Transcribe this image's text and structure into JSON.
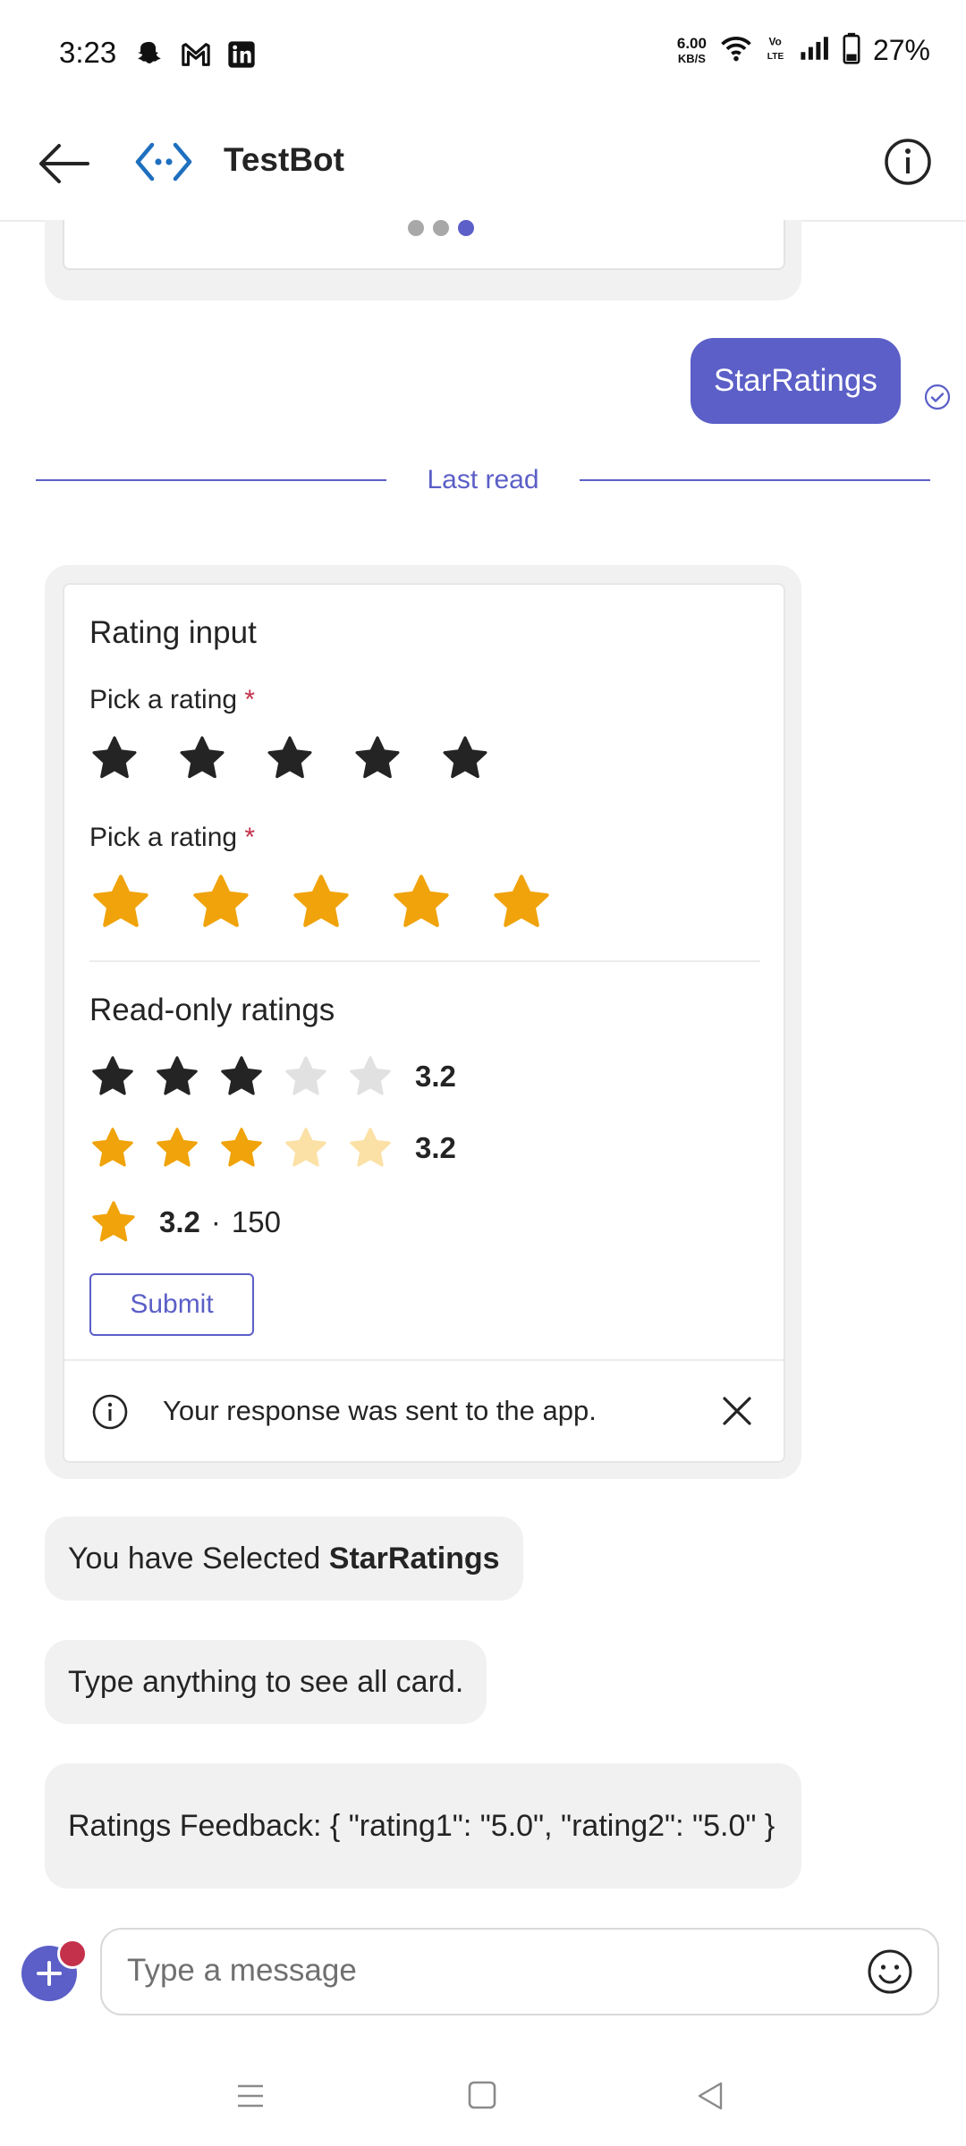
{
  "status_bar": {
    "time": "3:23",
    "net_speed_value": "6.00",
    "net_speed_unit": "KB/S",
    "battery": "27%",
    "icons": [
      "snapchat-icon",
      "gmail-icon",
      "linkedin-icon",
      "wifi-icon",
      "volte-icon",
      "signal-icon",
      "battery-icon"
    ]
  },
  "header": {
    "title": "TestBot",
    "icons": [
      "back-arrow-icon",
      "bot-icon",
      "info-icon"
    ]
  },
  "carousel": {
    "total": 3,
    "active": 3
  },
  "sent_message": "StarRatings",
  "last_read_label": "Last read",
  "card": {
    "title": "Rating input",
    "pick1_label": "Pick a rating",
    "pick2_label": "Pick a rating",
    "required_mark": "*",
    "star_input_1": {
      "count": 5,
      "color": "#242424"
    },
    "star_input_2": {
      "count": 5,
      "color": "#f0a30a"
    },
    "readonly_title": "Read-only ratings",
    "readonly_1": {
      "value": "3.2",
      "filled": 3,
      "total": 5,
      "color": "#242424"
    },
    "readonly_2": {
      "value": "3.2",
      "filled": 3,
      "total": 5,
      "color": "#f0a30a"
    },
    "readonly_3": {
      "value": "3.2",
      "separator": "·",
      "count": "150"
    },
    "submit_label": "Submit",
    "notice_text": "Your response was sent to the app."
  },
  "messages": {
    "selected_prefix": "You have Selected",
    "selected_bold": "StarRatings",
    "hint": "Type anything to see all card.",
    "feedback": "Ratings Feedback: { \"rating1\": \"5.0\", \"rating2\": \"5.0\" }"
  },
  "composer": {
    "placeholder": "Type a message"
  },
  "colors": {
    "accent": "#5b5fc7",
    "star_gold": "#f0a30a",
    "bubble_bg": "#f1f1f1",
    "required": "#c4314b"
  }
}
